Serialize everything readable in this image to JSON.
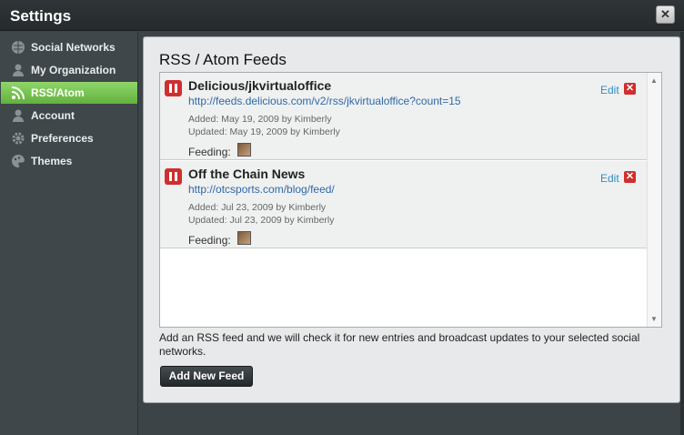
{
  "window": {
    "title": "Settings",
    "close_label": "✕"
  },
  "sidebar": {
    "items": [
      {
        "label": "Social Networks",
        "icon": "globe-icon",
        "active": false
      },
      {
        "label": "My Organization",
        "icon": "person-icon",
        "active": false
      },
      {
        "label": "RSS/Atom",
        "icon": "rss-icon",
        "active": true
      },
      {
        "label": "Account",
        "icon": "person-icon",
        "active": false
      },
      {
        "label": "Preferences",
        "icon": "gear-icon",
        "active": false
      },
      {
        "label": "Themes",
        "icon": "palette-icon",
        "active": false
      }
    ]
  },
  "main": {
    "title": "RSS / Atom Feeds",
    "feeds": [
      {
        "name": "Delicious/jkvirtualoffice",
        "url": "http://feeds.delicious.com/v2/rss/jkvirtualoffice?count=15",
        "added": "Added: May 19, 2009 by Kimberly",
        "updated": "Updated: May 19, 2009 by Kimberly",
        "feeding_label": "Feeding:",
        "edit_label": "Edit",
        "delete_label": "✕"
      },
      {
        "name": "Off the Chain News",
        "url": "http://otcsports.com/blog/feed/",
        "added": "Added: Jul 23, 2009 by Kimberly",
        "updated": "Updated: Jul 23, 2009 by Kimberly",
        "feeding_label": "Feeding:",
        "edit_label": "Edit",
        "delete_label": "✕"
      }
    ],
    "help_text": "Add an RSS feed and we will check it for new entries and broadcast updates to your selected social networks.",
    "add_button_label": "Add New Feed"
  },
  "colors": {
    "accent": "#6cbf45",
    "danger": "#cf2f2f",
    "link": "#2f69a8"
  }
}
